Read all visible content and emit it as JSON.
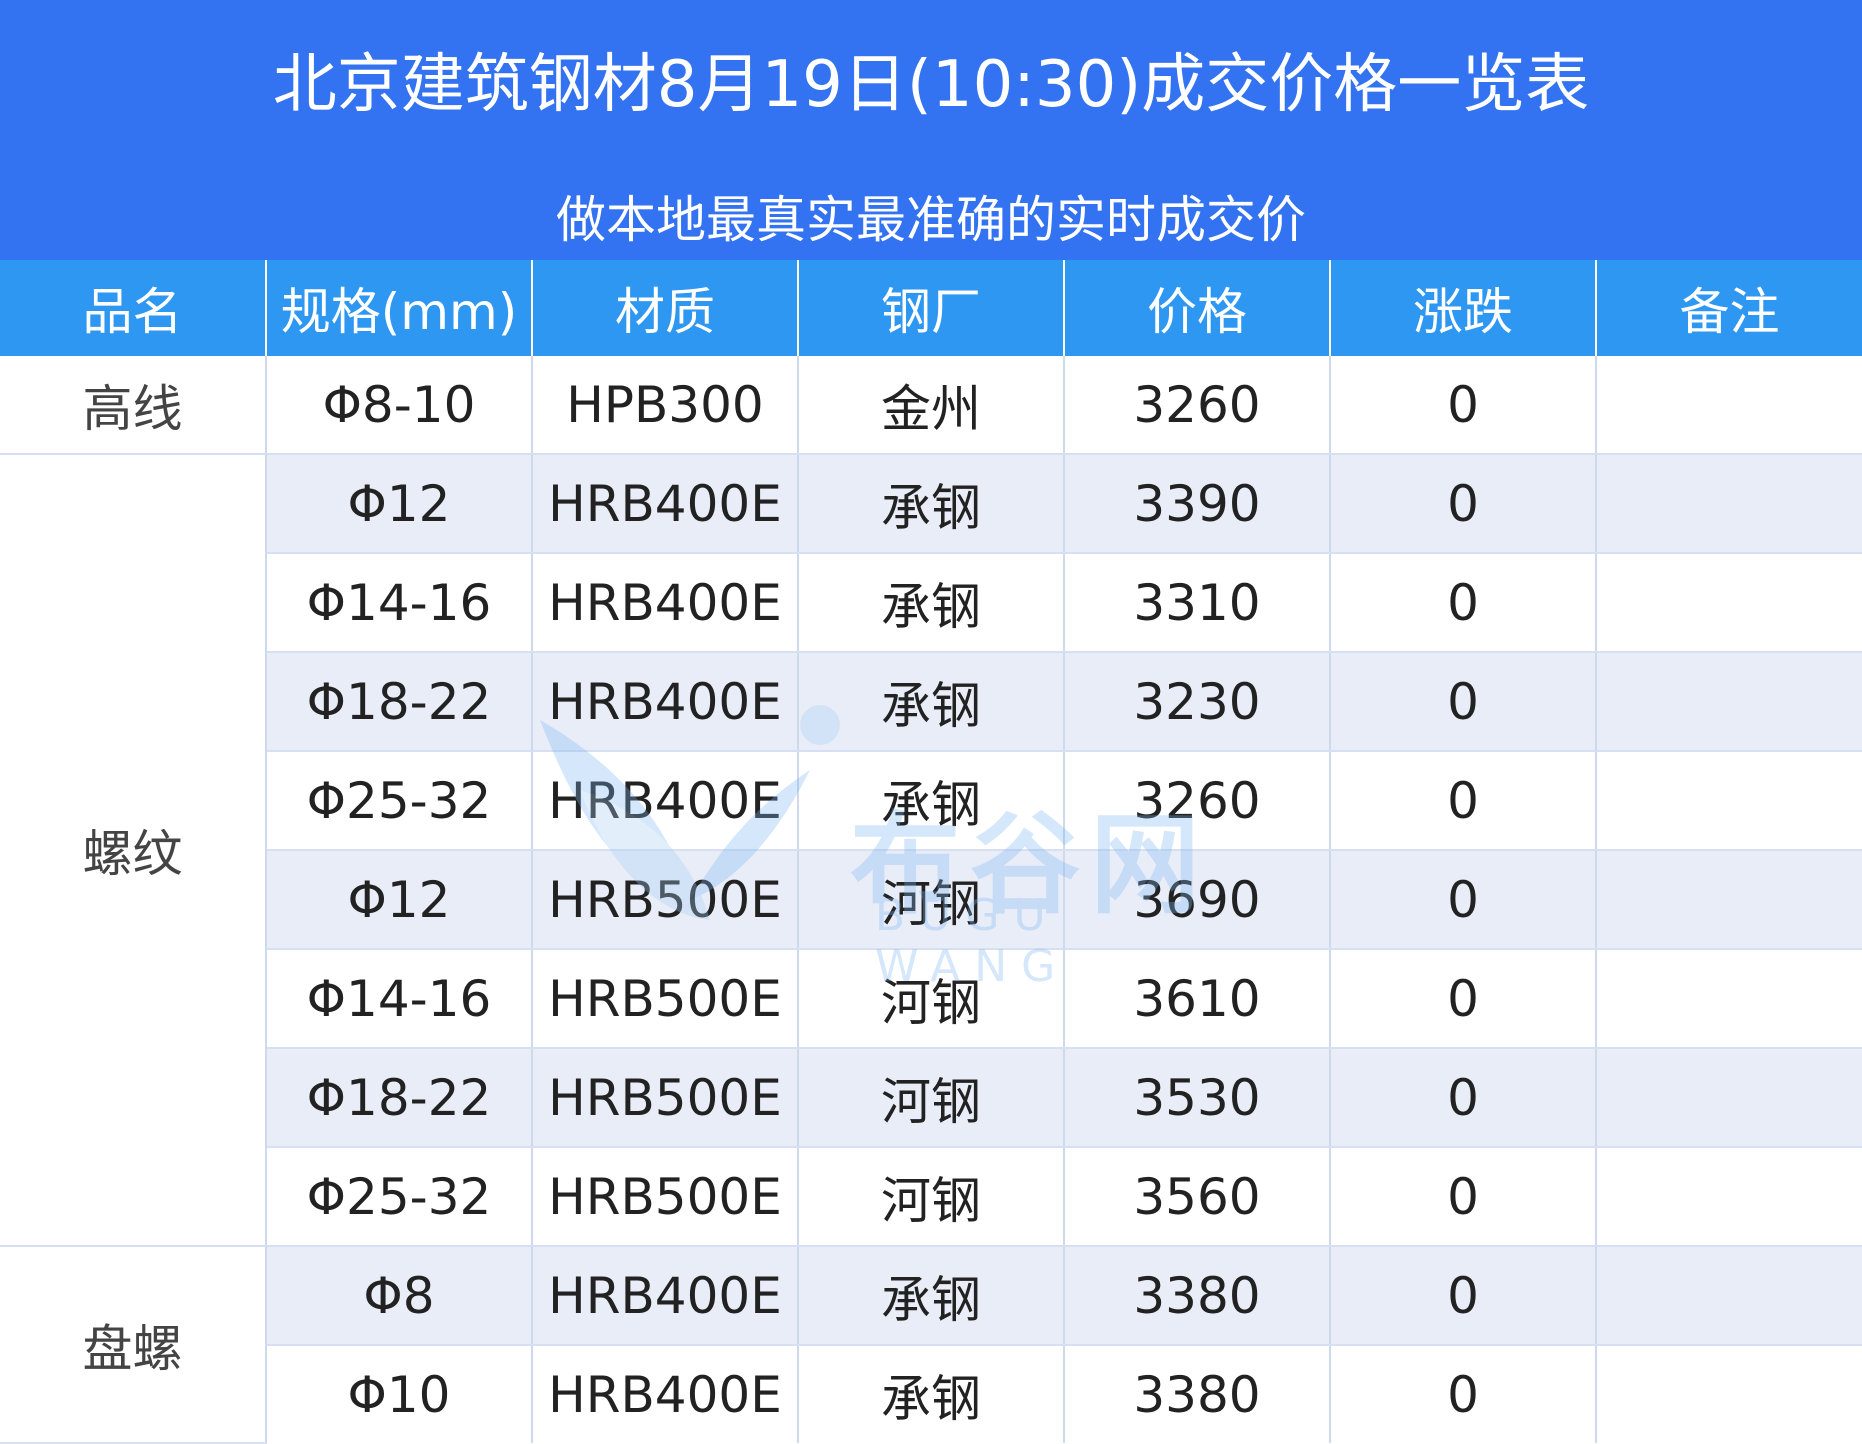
{
  "header": {
    "title": "北京建筑钢材8月19日(10:30)成交价格一览表",
    "subtitle": "做本地最真实最准确的实时成交价"
  },
  "table": {
    "columns": [
      "品名",
      "规格(mm)",
      "材质",
      "钢厂",
      "价格",
      "涨跌",
      "备注"
    ],
    "groups": [
      {
        "name": "高线",
        "rows": [
          {
            "spec": "Φ8-10",
            "grade": "HPB300",
            "mill": "金州",
            "price": "3260",
            "change": "0",
            "note": ""
          }
        ]
      },
      {
        "name": "螺纹",
        "rows": [
          {
            "spec": "Φ12",
            "grade": "HRB400E",
            "mill": "承钢",
            "price": "3390",
            "change": "0",
            "note": ""
          },
          {
            "spec": "Φ14-16",
            "grade": "HRB400E",
            "mill": "承钢",
            "price": "3310",
            "change": "0",
            "note": ""
          },
          {
            "spec": "Φ18-22",
            "grade": "HRB400E",
            "mill": "承钢",
            "price": "3230",
            "change": "0",
            "note": ""
          },
          {
            "spec": "Φ25-32",
            "grade": "HRB400E",
            "mill": "承钢",
            "price": "3260",
            "change": "0",
            "note": ""
          },
          {
            "spec": "Φ12",
            "grade": "HRB500E",
            "mill": "河钢",
            "price": "3690",
            "change": "0",
            "note": ""
          },
          {
            "spec": "Φ14-16",
            "grade": "HRB500E",
            "mill": "河钢",
            "price": "3610",
            "change": "0",
            "note": ""
          },
          {
            "spec": "Φ18-22",
            "grade": "HRB500E",
            "mill": "河钢",
            "price": "3530",
            "change": "0",
            "note": ""
          },
          {
            "spec": "Φ25-32",
            "grade": "HRB500E",
            "mill": "河钢",
            "price": "3560",
            "change": "0",
            "note": ""
          }
        ]
      },
      {
        "name": "盘螺",
        "rows": [
          {
            "spec": "Φ8",
            "grade": "HRB400E",
            "mill": "承钢",
            "price": "3380",
            "change": "0",
            "note": ""
          },
          {
            "spec": "Φ10",
            "grade": "HRB400E",
            "mill": "承钢",
            "price": "3380",
            "change": "0",
            "note": ""
          }
        ]
      }
    ]
  },
  "watermark": {
    "text_cn": "布谷网",
    "text_en": "BUGU WANG",
    "icon": "bird-logo-icon"
  },
  "colors": {
    "header_bg": "#3372F0",
    "column_header_bg": "#2E97F2",
    "stripe_bg": "#E9EDF8"
  }
}
